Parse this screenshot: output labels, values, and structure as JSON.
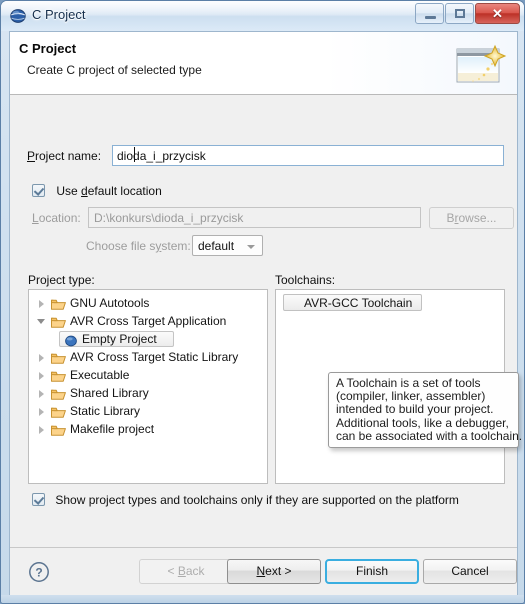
{
  "window": {
    "title": "C Project",
    "icon": "eclipse-sphere-icon",
    "controls": {
      "minimize": "–",
      "maximize": "□",
      "close": "✕"
    }
  },
  "wizard": {
    "title": "C Project",
    "subtitle": "Create C project of selected type",
    "banner_icon": "new-project-wizard-icon"
  },
  "form": {
    "project_name": {
      "label_pre": "P",
      "label_underlined": "",
      "label": "Project name:",
      "value": "dioda_i_przycisk",
      "placeholder": ""
    },
    "use_default_location": {
      "label_a": "Use ",
      "label_u": "d",
      "label_b": "efault location",
      "checked": true
    },
    "location": {
      "label_u": "L",
      "label_b": "ocation:",
      "value": "D:\\konkurs\\dioda_i_przycisk",
      "enabled": false
    },
    "browse_button": {
      "label_a": "B",
      "label_u": "r",
      "label_b": "owse...",
      "enabled": false
    },
    "file_system": {
      "label_a": "Choose file s",
      "label_u": "y",
      "label_b": "stem:",
      "value": "default",
      "options": [
        "default"
      ]
    }
  },
  "project_type": {
    "label": "Project type:",
    "items": [
      {
        "label": "GNU Autotools",
        "icon": "folder-icon",
        "expanded": false,
        "selected": false,
        "depth": 0
      },
      {
        "label": "AVR Cross Target Application",
        "icon": "folder-icon",
        "expanded": true,
        "selected": false,
        "depth": 0
      },
      {
        "label": "Empty Project",
        "icon": "blue-sphere-icon",
        "expanded": null,
        "selected": true,
        "depth": 1
      },
      {
        "label": "AVR Cross Target Static Library",
        "icon": "folder-icon",
        "expanded": false,
        "selected": false,
        "depth": 0
      },
      {
        "label": "Executable",
        "icon": "folder-icon",
        "expanded": false,
        "selected": false,
        "depth": 0
      },
      {
        "label": "Shared Library",
        "icon": "folder-icon",
        "expanded": false,
        "selected": false,
        "depth": 0
      },
      {
        "label": "Static Library",
        "icon": "folder-icon",
        "expanded": false,
        "selected": false,
        "depth": 0
      },
      {
        "label": "Makefile project",
        "icon": "folder-icon",
        "expanded": false,
        "selected": false,
        "depth": 0
      }
    ]
  },
  "toolchains": {
    "label": "Toolchains:",
    "items": [
      {
        "label": "AVR-GCC Toolchain",
        "selected": true
      }
    ]
  },
  "tooltip": {
    "lines": [
      "A Toolchain is a set of tools",
      "(compiler, linker, assembler)",
      "intended to build your project.",
      "Additional tools, like a debugger,",
      "can be associated with a toolchain."
    ]
  },
  "show_supported": {
    "label": "Show project types and toolchains only if they are supported on the platform",
    "checked": true
  },
  "footer": {
    "help_icon": "help-question-icon",
    "back": {
      "a": "< ",
      "u": "B",
      "b": "ack",
      "enabled": false
    },
    "next": {
      "a": "",
      "u": "N",
      "b": "ext >",
      "enabled": true
    },
    "finish": {
      "label": "Finish",
      "default": true
    },
    "cancel": {
      "label": "Cancel"
    }
  },
  "colors": {
    "accent": "#3aaee0",
    "titlebar_text": "#17304d",
    "folder": "#e8a317",
    "sphere": "#3b74bd"
  }
}
